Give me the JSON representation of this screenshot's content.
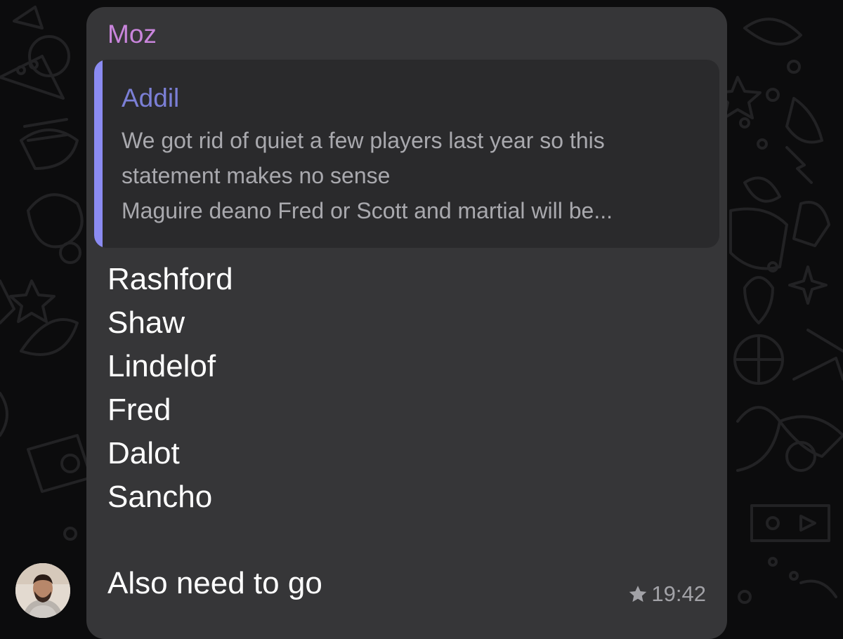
{
  "message": {
    "sender": "Moz",
    "reply_to": {
      "name": "Addil",
      "lines": [
        "We got rid of quiet a few players last year so this",
        "statement makes no sense",
        "Maguire deano Fred or Scott and martial will be..."
      ]
    },
    "lines": [
      "Rashford",
      "Shaw",
      "Lindelof",
      "Fred",
      "Dalot",
      "Sancho"
    ],
    "tail": "Also need to go",
    "time": "19:42",
    "status_icon": "star-icon"
  },
  "colors": {
    "background": "#0c0c0d",
    "bubble": "#363638",
    "sender_name": "#c985dc",
    "reply_name": "#7b7fd6",
    "reply_bar": "#8b8bf2",
    "reply_text": "#a9a9ae",
    "message_text": "#ffffff",
    "meta": "#a2a2a7"
  }
}
